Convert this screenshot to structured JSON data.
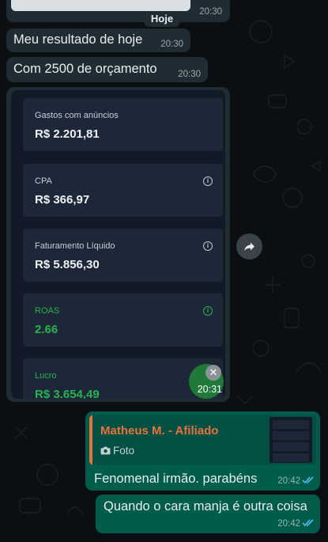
{
  "date_separator": "Hoje",
  "messages": {
    "top_clipped": {
      "time": "20:30"
    },
    "m1": {
      "text": "Meu resultado de hoje",
      "time": "20:30"
    },
    "m2": {
      "text": "Com 2500 de orçamento",
      "time": "20:30"
    },
    "image": {
      "time": "20:31",
      "cards": [
        {
          "label": "Gastos com anúncios",
          "value": "R$ 2.201,81"
        },
        {
          "label": "CPA",
          "value": "R$ 366,97"
        },
        {
          "label": "Faturamento Líquido",
          "value": "R$ 5.856,30"
        },
        {
          "label": "ROAS",
          "value": "2.66"
        },
        {
          "label": "Lucro",
          "value": "R$ 3.654,49"
        }
      ]
    },
    "reply": {
      "quoted_author": "Matheus M. - Afiliado",
      "quoted_kind": "Foto",
      "text": "Fenomenal irmão. parabéns",
      "time": "20:42"
    },
    "m4": {
      "text": "Quando o cara manja é outra coisa",
      "time": "20:42"
    }
  },
  "colors": {
    "incoming": "#202c33",
    "outgoing": "#005c4b",
    "quote_accent": "#e9713b",
    "read_ticks": "#53bdeb",
    "positive": "#25b34f"
  }
}
